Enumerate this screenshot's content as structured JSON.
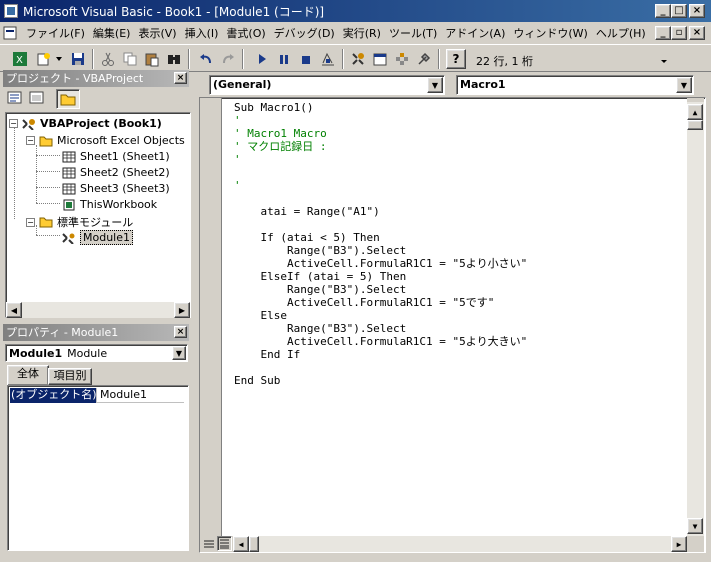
{
  "window": {
    "title": "Microsoft Visual Basic - Book1 - [Module1 (コード)]"
  },
  "menu": [
    "ファイル(F)",
    "編集(E)",
    "表示(V)",
    "挿入(I)",
    "書式(O)",
    "デバッグ(D)",
    "実行(R)",
    "ツール(T)",
    "アドイン(A)",
    "ウィンドウ(W)",
    "ヘルプ(H)"
  ],
  "toolbar": {
    "position": "22 行, 1 桁"
  },
  "project": {
    "title": "プロジェクト - VBAProject",
    "root": "VBAProject (Book1)",
    "excel_objects": "Microsoft Excel Objects",
    "sheets": [
      "Sheet1 (Sheet1)",
      "Sheet2 (Sheet2)",
      "Sheet3 (Sheet3)",
      "ThisWorkbook"
    ],
    "modules_folder": "標準モジュール",
    "module": "Module1"
  },
  "properties": {
    "title": "プロパティ - Module1",
    "object_name": "Module1",
    "object_type": "Module",
    "tabs": [
      "全体",
      "項目別"
    ],
    "prop_name": "(オブジェクト名)",
    "prop_value": "Module1"
  },
  "editor": {
    "object_combo": "(General)",
    "proc_combo": "Macro1",
    "lines": [
      {
        "t": "Sub Macro1()",
        "c": "kw"
      },
      {
        "t": "'",
        "c": "cmt"
      },
      {
        "t": "' Macro1 Macro",
        "c": "cmt"
      },
      {
        "t": "' マクロ記録日 :",
        "c": "cmt"
      },
      {
        "t": "'",
        "c": "cmt"
      },
      {
        "t": "",
        "c": ""
      },
      {
        "t": "'",
        "c": "cmt"
      },
      {
        "t": "",
        "c": ""
      },
      {
        "t": "    atai = Range(\"A1\")",
        "c": ""
      },
      {
        "t": "",
        "c": ""
      },
      {
        "t": "    If (atai < 5) Then",
        "c": "kw"
      },
      {
        "t": "        Range(\"B3\").Select",
        "c": ""
      },
      {
        "t": "        ActiveCell.FormulaR1C1 = \"5より小さい\"",
        "c": ""
      },
      {
        "t": "    ElseIf (atai = 5) Then",
        "c": "kw"
      },
      {
        "t": "        Range(\"B3\").Select",
        "c": ""
      },
      {
        "t": "        ActiveCell.FormulaR1C1 = \"5です\"",
        "c": ""
      },
      {
        "t": "    Else",
        "c": "kw"
      },
      {
        "t": "        Range(\"B3\").Select",
        "c": ""
      },
      {
        "t": "        ActiveCell.FormulaR1C1 = \"5より大きい\"",
        "c": ""
      },
      {
        "t": "    End If",
        "c": "kw"
      },
      {
        "t": "",
        "c": ""
      },
      {
        "t": "End Sub",
        "c": "kw"
      }
    ]
  }
}
